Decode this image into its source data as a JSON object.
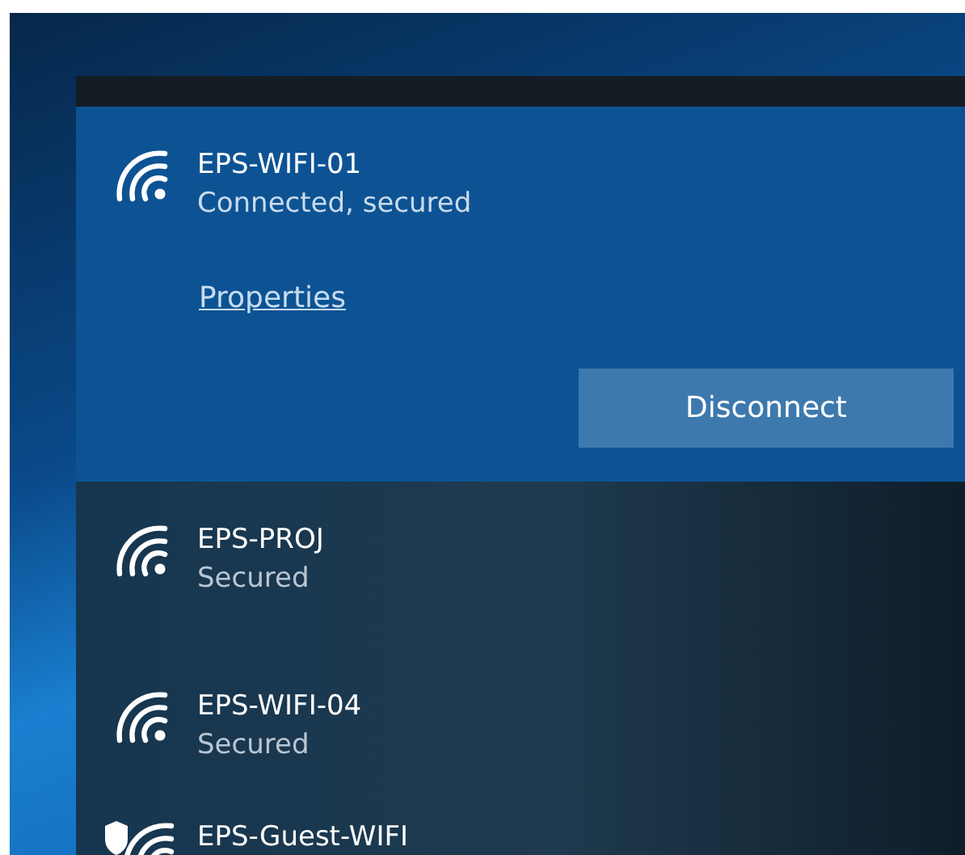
{
  "networks": [
    {
      "kind": "wifi",
      "name": "EPS-WIFI-01",
      "status": "Connected, secured",
      "selected": true,
      "link": "Properties",
      "button": "Disconnect"
    },
    {
      "kind": "wifi",
      "name": "EPS-PROJ",
      "status": "Secured",
      "selected": false
    },
    {
      "kind": "wifi",
      "name": "EPS-WIFI-04",
      "status": "Secured",
      "selected": false
    },
    {
      "kind": "wifi-shield",
      "name": "EPS-Guest-WIFI",
      "selected": false
    }
  ]
}
